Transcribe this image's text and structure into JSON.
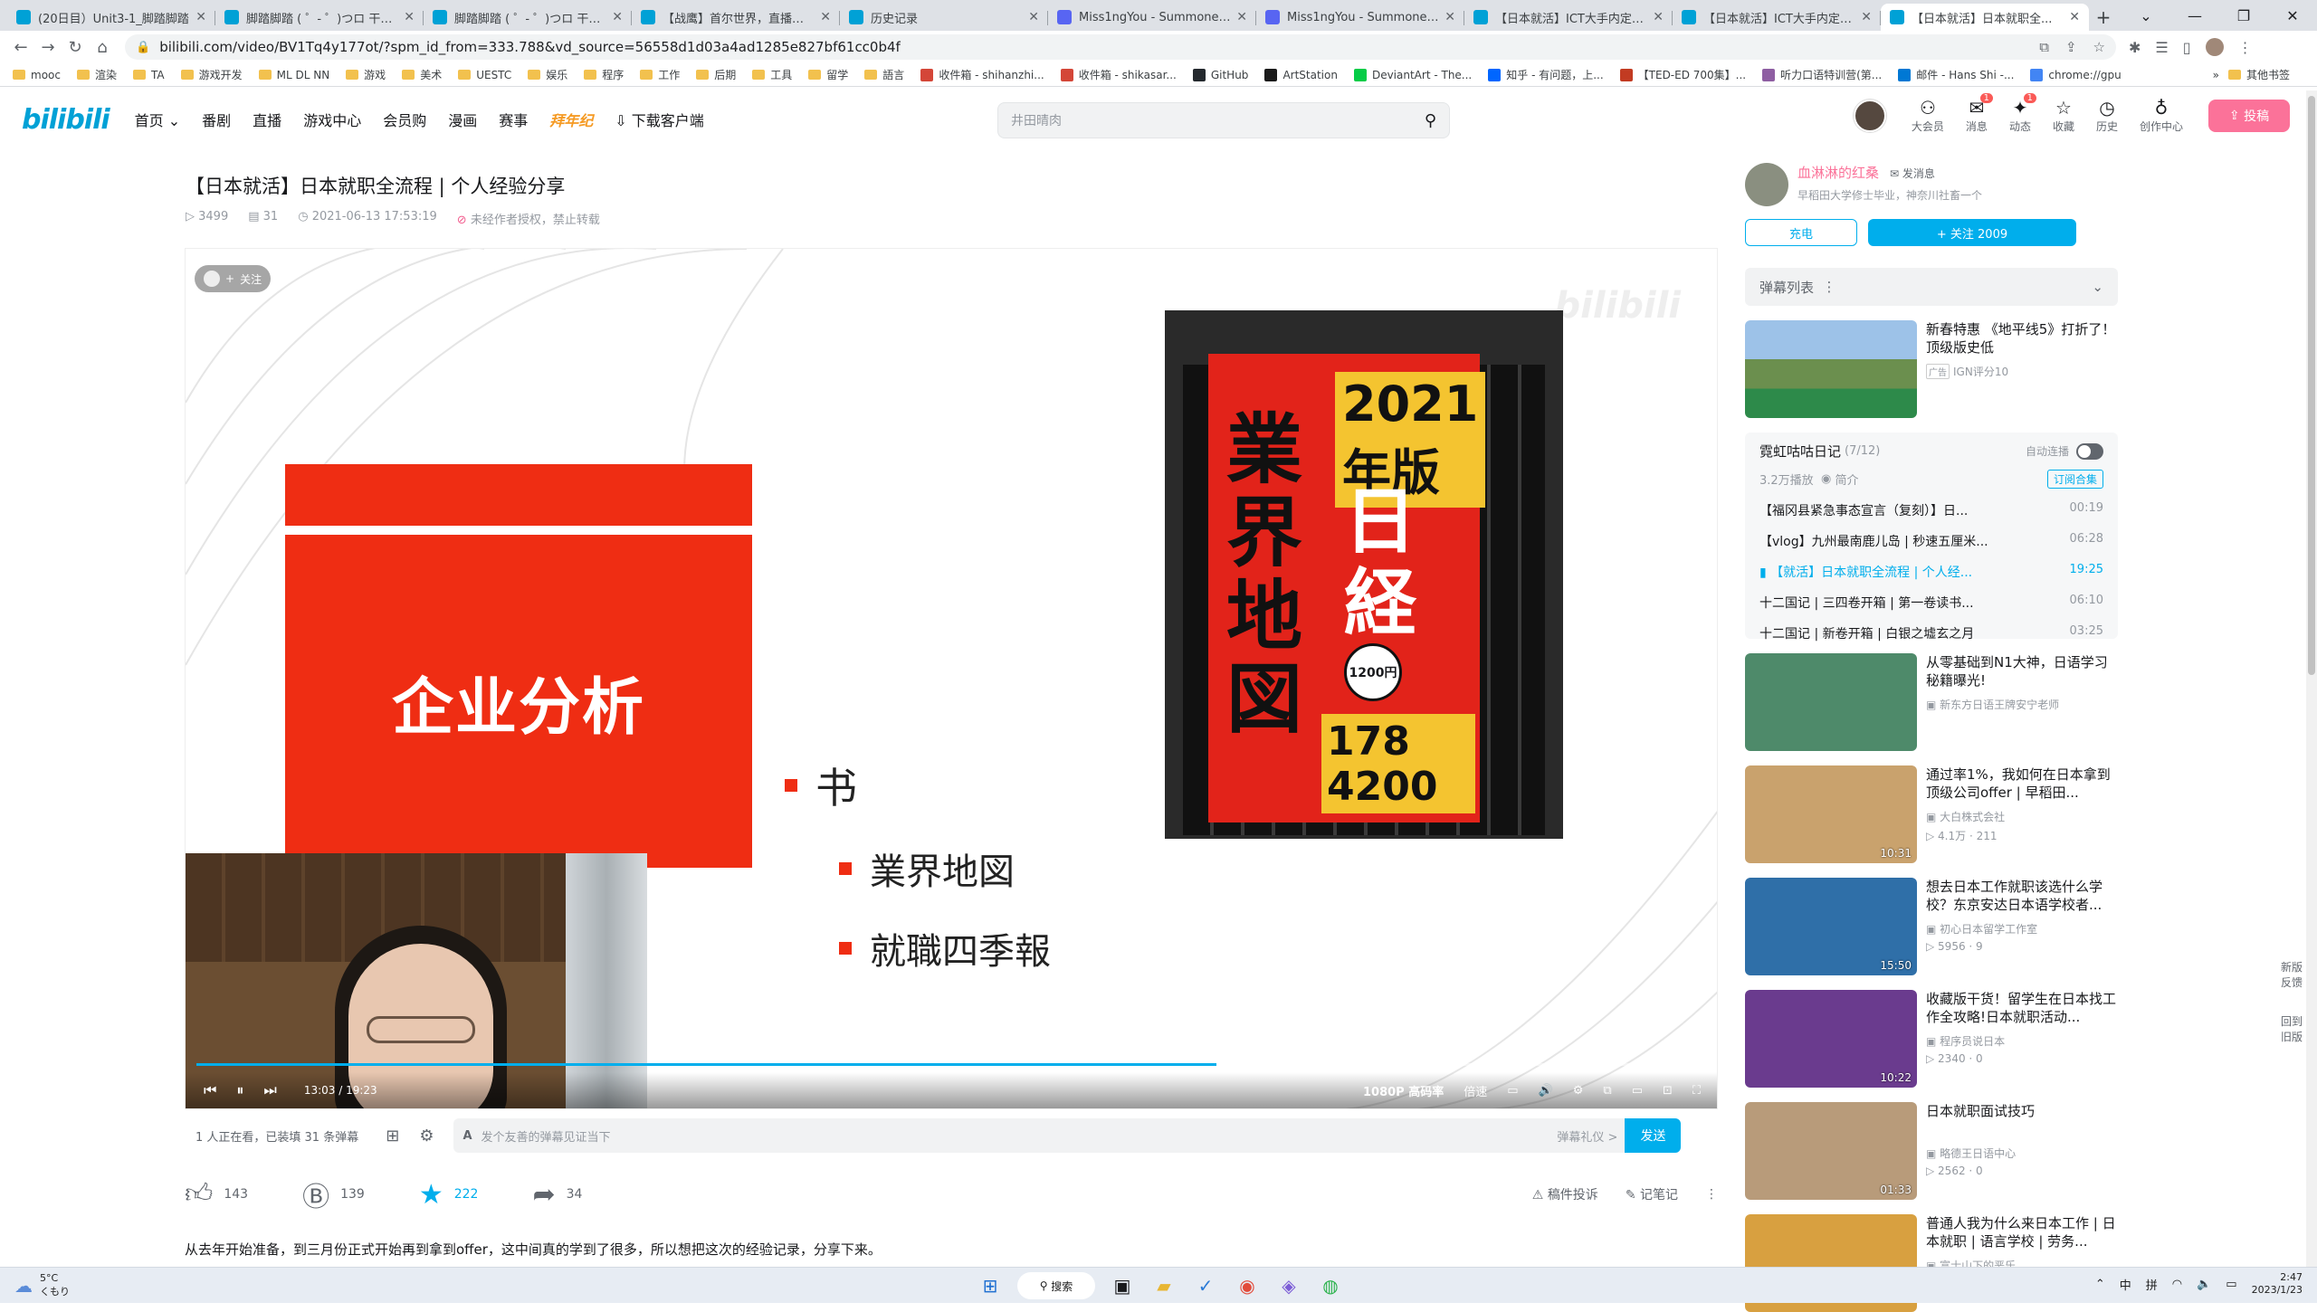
{
  "browser": {
    "tabs": [
      {
        "title": "(20日目）Unit3-1_脚踏脚踏",
        "color": "#00a1d6"
      },
      {
        "title": "脚踏脚踏 ( ゜- ゜)つロ 干杯~-bilibili",
        "color": "#00a1d6"
      },
      {
        "title": "脚踏脚踏 ( ゜- ゜)つロ 干杯~-bilibili",
        "color": "#00a1d6"
      },
      {
        "title": "【战鹰】首尔世界，直播从新...",
        "color": "#00a1d6"
      },
      {
        "title": "历史记录",
        "color": "#00a1d6"
      },
      {
        "title": "Miss1ngYou - Summoner Stats",
        "color": "#5865f2"
      },
      {
        "title": "Miss1ngYou - Summoner Stats",
        "color": "#5865f2"
      },
      {
        "title": "【日本就活】ICT大手内定个人...",
        "color": "#00a1d6"
      },
      {
        "title": "【日本就活】ICT大手内定个人...",
        "color": "#00a1d6"
      },
      {
        "title": "【日本就活】日本就职全...",
        "color": "#00a1d6",
        "active": true
      }
    ],
    "url": "bilibili.com/video/BV1Tq4y177ot/?spm_id_from=333.788&vd_source=56558d1d03a4ad1285e827bf61cc0b4f",
    "bookmarks": [
      "mooc",
      "渲染",
      "TA",
      "游戏开发",
      "ML DL NN",
      "游戏",
      "美术",
      "UESTC",
      "娱乐",
      "程序",
      "工作",
      "后期",
      "工具",
      "留学",
      "語言",
      "收件箱 - shihanzhi...",
      "收件箱 - shikasar...",
      "GitHub",
      "ArtStation",
      "DeviantArt - The...",
      "知乎 - 有问题，上...",
      "【TED-ED 700集】...",
      "听力口语特训营(第...",
      "邮件 - Hans Shi -...",
      "chrome://gpu"
    ],
    "bookmarks_more": "其他书签"
  },
  "header": {
    "logo": "bilibili",
    "nav": [
      "首页",
      "番剧",
      "直播",
      "游戏中心",
      "会员购",
      "漫画",
      "赛事"
    ],
    "nav_highlight": "拜年纪",
    "download": "下载客户端",
    "search_placeholder": "井田晴肉",
    "icons": [
      {
        "label": "大会员",
        "badge": ""
      },
      {
        "label": "消息",
        "badge": "1"
      },
      {
        "label": "动态",
        "badge": "1"
      },
      {
        "label": "收藏",
        "badge": ""
      },
      {
        "label": "历史",
        "badge": ""
      },
      {
        "label": "创作中心",
        "badge": ""
      }
    ],
    "upload": "投稿"
  },
  "video": {
    "title": "【日本就活】日本就职全流程 | 个人经验分享",
    "views": "3499",
    "danmaku_count": "31",
    "date": "2021-06-13 17:53:19",
    "notice": "未经作者授权，禁止转载",
    "slide": {
      "heading": "企业分析",
      "bullet1": "书",
      "bullet2": "業界地図",
      "bullet3": "就職四季報"
    },
    "book": {
      "year": "2021年版",
      "title_left": "業界地図",
      "title_right": "日経",
      "price": "1200円",
      "numbers": "178 4200"
    },
    "watermark": "bilibili",
    "follow_pill": "关注",
    "player": {
      "time": "13:03 / 19:23",
      "progress": 0.675,
      "quality": "1080P 高码率",
      "speed": "倍速"
    },
    "danmaku_bar": {
      "status": "1 人正在看，已装填 31 条弹幕",
      "placeholder": "发个友善的弹幕见证当下",
      "etiquette": "弹幕礼仪 >",
      "send": "发送"
    },
    "actions": {
      "like": "143",
      "coin": "139",
      "fav": "222",
      "share": "34",
      "report": "稿件投诉",
      "notes": "记笔记"
    },
    "description": "从去年开始准备，到三月份正式开始再到拿到offer，这中间真的学到了很多，所以想把这次的经验记录，分享下来。"
  },
  "uploader": {
    "name": "血淋淋的红桑",
    "message": "发消息",
    "bio": "早稻田大学修士毕业，神奈川社畜一个",
    "charge": "充电",
    "follow": "+ 关注 2009"
  },
  "sidebar": {
    "danmaku_list": "弹幕列表",
    "ad": {
      "title": "新春特惠 《地平线5》打折了！顶级版史低",
      "author": "IGN评分10",
      "tag": "广告"
    },
    "collection": {
      "name": "霓虹咕咕日记",
      "count": "(7/12)",
      "autoplay": "自动连播",
      "plays": "3.2万播放",
      "intro": "简介",
      "subscribe": "订阅合集",
      "episodes": [
        {
          "title": "【福冈县紧急事态宣言（复刻）】日...",
          "dur": "00:19"
        },
        {
          "title": "【vlog】九州最南鹿儿岛 | 秒速五厘米...",
          "dur": "06:28"
        },
        {
          "title": "【就活】日本就职全流程 | 个人经...",
          "dur": "19:25",
          "current": true
        },
        {
          "title": "十二国记 | 三四卷开箱 | 第一卷读书...",
          "dur": "06:10"
        },
        {
          "title": "十二国记 | 新卷开箱 | 白银之墟玄之月",
          "dur": "03:25"
        }
      ]
    },
    "recommendations": [
      {
        "title": "从零基础到N1大神，日语学习秘籍曝光!",
        "author": "新东方日语王牌安宁老师",
        "stats": "",
        "dur": "",
        "color": "#4e8a6a"
      },
      {
        "title": "通过率1%，我如何在日本拿到顶级公司offer | 早稻田...",
        "author": "大白株式会社",
        "stats": "4.1万 · 211",
        "dur": "10:31",
        "color": "#c9a26d"
      },
      {
        "title": "想去日本工作就职该选什么学校？东京安达日本语学校者...",
        "author": "初心日本留学工作室",
        "stats": "5956 · 9",
        "dur": "15:50",
        "color": "#2f6fa8"
      },
      {
        "title": "收藏版干货！留学生在日本找工作全攻略!日本就职活动...",
        "author": "程序员说日本",
        "stats": "2340 · 0",
        "dur": "10:22",
        "color": "#6a3b8e"
      },
      {
        "title": "日本就职面试技巧",
        "author": "略德王日语中心",
        "stats": "2562 · 0",
        "dur": "01:33",
        "color": "#b89b7a"
      },
      {
        "title": "普通人我为什么来日本工作 | 日本就职 | 语言学校 | 劳务...",
        "author": "富士山下的恶乐",
        "stats": "",
        "dur": "",
        "color": "#d8a040"
      }
    ],
    "float": [
      "新版反馈",
      "回到旧版"
    ]
  },
  "taskbar": {
    "temp": "5°C",
    "weather": "くもり",
    "search": "搜索",
    "ime": "中",
    "ime2": "拼",
    "time": "2:47",
    "date": "2023/1/23"
  }
}
